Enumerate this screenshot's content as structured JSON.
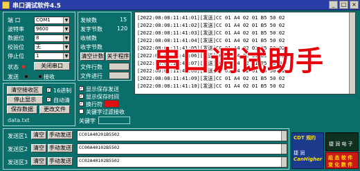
{
  "window": {
    "title": "串口调试软件4.5",
    "min": "_",
    "max": "□",
    "close": "×"
  },
  "settings": {
    "port_label": "端  口",
    "port_value": "COM1",
    "baud_label": "波特率",
    "baud_value": "9600",
    "databits_label": "数据位",
    "databits_value": "8",
    "parity_label": "校验位",
    "parity_value": "无",
    "stopbits_label": "停止位",
    "stopbits_value": "1",
    "status_label": "状态",
    "close_port_button": "关闭串口",
    "send_label": "发送",
    "recv_label": "接收"
  },
  "counters": {
    "sent_frames_label": "发帧数",
    "sent_frames_value": "15",
    "sent_bytes_label": "发字节数",
    "sent_bytes_value": "120",
    "recv_frames_label": "收帧数",
    "recv_bytes_label": "收字节数",
    "clear_count_button": "清空计数",
    "close_app_button": "关于程序",
    "file_lines_label": "文件行数",
    "file_progress_label": "文件进行"
  },
  "receive": {
    "lines": [
      "[2022:08:08:11:41:01][发送]CC 01 A4 02 01 B5 50 02",
      "[2022:08:08:11:41:02][发送]CC 01 A4 02 01 B5 50 02",
      "[2022:08:08:11:41:03][发送]CC 01 A4 02 01 B5 50 02",
      "[2022:08:08:11:41:04][发送]CC 01 A4 02 01 B5 50 02",
      "[2022:08:08:11:41:05][发送]CC 01 A4 02 01 B5 50 02",
      "[2022:08:08:11:41:06][发送]CC 01 A4 02 01 B5 50 02",
      "[2022:08:08:11:41:07][发送]CC 01 A4 02 01 B5 50 02",
      "[2022:08:08:11:41:08][发送]CC 01 A4 02 01 B5 50 02",
      "[2022:08:08:11:41:09][发送]CC 01 A4 02 01 B5 50 02",
      "[2022:08:08:11:41:10][发送]CC 01 A4 02 01 B5 50 02"
    ],
    "overlay_title": "串口调试助手"
  },
  "controls": {
    "clear_recv_button": "清空接收区",
    "hex_label": "16进制",
    "stop_display_button": "停止显示",
    "auto_clear_label": "自动清",
    "save_data_button": "保存数据",
    "change_file_button": "更改文件",
    "filename": "data.txt",
    "show_send_label": "显示保存发送",
    "show_time_label": "显示保存时间",
    "newline_label": "换行符",
    "newline_value": "",
    "filter_label": "关键字过滤接收",
    "keyword_label": "关键字"
  },
  "send_rows": [
    {
      "label": "发送区1",
      "clear": "清空",
      "manual": "手动发送",
      "content": "CC01A40201B5502"
    },
    {
      "label": "发送区2",
      "clear": "清空",
      "manual": "手动发送",
      "content": "CC00A40102B5502"
    },
    {
      "label": "发送区3",
      "clear": "清空",
      "manual": "手动发送",
      "content": "CC02A40102B5502"
    }
  ],
  "ads": {
    "a1_line1": "CDT 规约",
    "a1_line2": "捷 润",
    "a1_line3": "CanHigher",
    "a1_line4": "",
    "a2_line1": "",
    "a2_line2": "捷 润 电 子",
    "a3_line1": "组 态 软 件",
    "a3_line2": "变 化 数 件"
  }
}
